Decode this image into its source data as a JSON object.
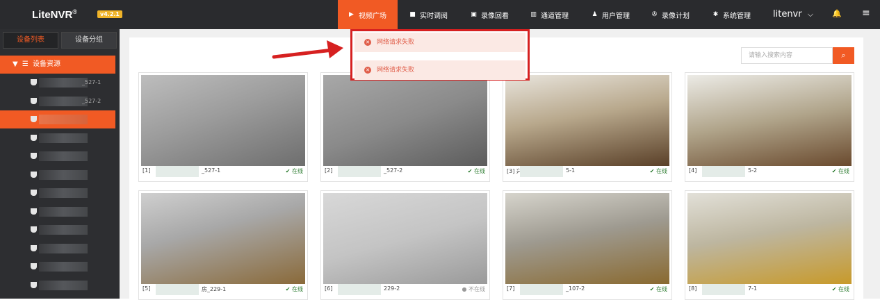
{
  "header": {
    "logo": "LiteNVR",
    "logo_mark": "®",
    "version": "v4.2.1",
    "nav": [
      {
        "label": "视频广场",
        "icon": "play-circle-icon",
        "active": true
      },
      {
        "label": "实时调阅",
        "icon": "video-camera-icon",
        "active": false
      },
      {
        "label": "录像回看",
        "icon": "playback-icon",
        "active": false
      },
      {
        "label": "通道管理",
        "icon": "columns-icon",
        "active": false
      },
      {
        "label": "用户管理",
        "icon": "user-icon",
        "active": false
      },
      {
        "label": "录像计划",
        "icon": "film-reel-icon",
        "active": false
      },
      {
        "label": "系统管理",
        "icon": "gear-icon",
        "active": false
      }
    ],
    "user": "litenvr",
    "user_caret": "⌵"
  },
  "sidebar": {
    "tabs": [
      {
        "label": "设备列表",
        "active": true
      },
      {
        "label": "设备分组",
        "active": false
      }
    ],
    "root_label": "设备资源",
    "devices": [
      {
        "suffix": "_527-1",
        "selected": false
      },
      {
        "suffix": "_527-2",
        "selected": false
      },
      {
        "suffix": "",
        "selected": true
      },
      {
        "suffix": "",
        "selected": false
      },
      {
        "suffix": "",
        "selected": false
      },
      {
        "suffix": "",
        "selected": false
      },
      {
        "suffix": "",
        "selected": false
      },
      {
        "suffix": "",
        "selected": false
      },
      {
        "suffix": "",
        "selected": false
      },
      {
        "suffix": "",
        "selected": false
      },
      {
        "suffix": "",
        "selected": false
      },
      {
        "suffix": "",
        "selected": false
      }
    ]
  },
  "search": {
    "placeholder": "请输入搜索内容"
  },
  "dropdown": {
    "items": [
      "网络请求失败",
      "网络请求失败"
    ]
  },
  "cards": [
    {
      "prefix": "[1]",
      "suffix": "_527-1",
      "status": "在线",
      "online": true
    },
    {
      "prefix": "[2]",
      "suffix": "_527-2",
      "status": "在线",
      "online": true
    },
    {
      "prefix": "[3] 兴",
      "suffix": "5-1",
      "status": "在线",
      "online": true
    },
    {
      "prefix": "[4]",
      "suffix": "5-2",
      "status": "在线",
      "online": true
    },
    {
      "prefix": "[5]",
      "suffix": "房_229-1",
      "status": "在线",
      "online": true
    },
    {
      "prefix": "[6]",
      "suffix": "229-2",
      "status": "不在线",
      "online": false
    },
    {
      "prefix": "[7]",
      "suffix": "_107-2",
      "status": "在线",
      "online": true
    },
    {
      "prefix": "[8]",
      "suffix": "7-1",
      "status": "在线",
      "online": true
    }
  ],
  "colors": {
    "accent": "#f15a24",
    "topbar": "#2a2b2e",
    "sidebar": "#2d2e31",
    "error": "#d62020",
    "online": "#2e7d32"
  }
}
